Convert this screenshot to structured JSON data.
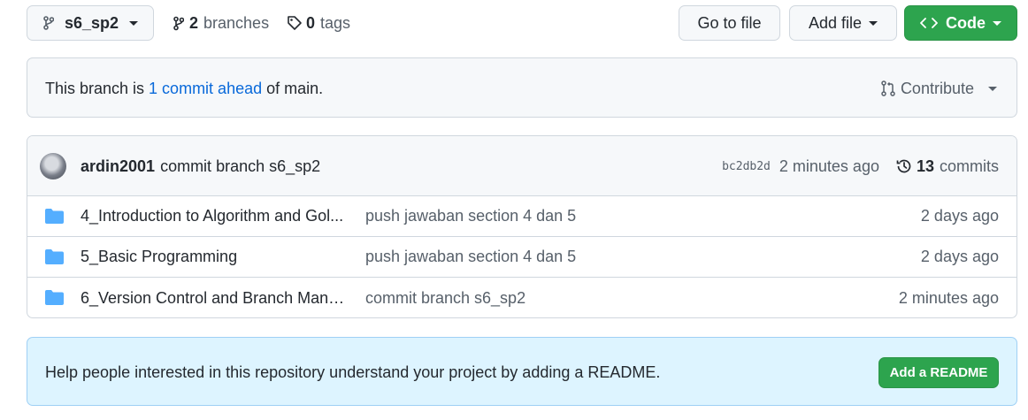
{
  "topbar": {
    "branch_name": "s6_sp2",
    "branches_count": "2",
    "branches_label": "branches",
    "tags_count": "0",
    "tags_label": "tags",
    "go_to_file": "Go to file",
    "add_file": "Add file",
    "code": "Code"
  },
  "ahead": {
    "prefix": "This branch is",
    "link": "1 commit ahead",
    "suffix": "of main.",
    "contribute": "Contribute"
  },
  "latest_commit": {
    "author": "ardin2001",
    "message": "commit branch s6_sp2",
    "sha": "bc2db2d",
    "age": "2 minutes ago",
    "commits_count": "13",
    "commits_label": "commits"
  },
  "files": [
    {
      "name": "4_Introduction to Algorithm and Gol...",
      "message": "push jawaban section 4 dan 5",
      "age": "2 days ago"
    },
    {
      "name": "5_Basic Programming",
      "message": "push jawaban section 4 dan 5",
      "age": "2 days ago"
    },
    {
      "name": "6_Version Control and Branch Manag...",
      "message": "commit branch s6_sp2",
      "age": "2 minutes ago"
    }
  ],
  "readme_prompt": {
    "text": "Help people interested in this repository understand your project by adding a README.",
    "button": "Add a README"
  },
  "colors": {
    "accent_blue": "#0969da",
    "green": "#2da44e",
    "folder_blue": "#54aeff",
    "readme_bg": "#ddf4ff"
  },
  "icons": [
    "branch-icon",
    "tag-icon",
    "chevron-code-icon",
    "pull-request-icon",
    "history-icon",
    "folder-icon"
  ]
}
